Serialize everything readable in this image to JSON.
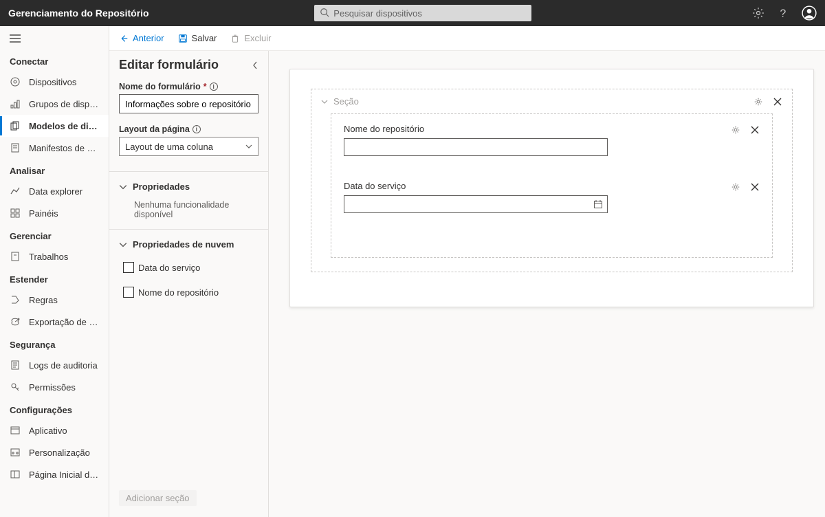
{
  "app": {
    "title": "Gerenciamento do Repositório"
  },
  "search": {
    "placeholder": "Pesquisar dispositivos"
  },
  "nav": {
    "groups": [
      {
        "title": "Conectar",
        "items": [
          {
            "icon": "device",
            "label": "Dispositivos"
          },
          {
            "icon": "group",
            "label": "Grupos de dispositivos"
          },
          {
            "icon": "template",
            "label": "Modelos de dispo...",
            "active": true
          },
          {
            "icon": "manifest",
            "label": "Manifestos de borda"
          }
        ]
      },
      {
        "title": "Analisar",
        "items": [
          {
            "icon": "chart",
            "label": "Data explorer"
          },
          {
            "icon": "dashboard",
            "label": "Painéis"
          }
        ]
      },
      {
        "title": "Gerenciar",
        "items": [
          {
            "icon": "jobs",
            "label": "Trabalhos"
          }
        ]
      },
      {
        "title": "Estender",
        "items": [
          {
            "icon": "rules",
            "label": "Regras"
          },
          {
            "icon": "export",
            "label": "Exportação de dados"
          }
        ]
      },
      {
        "title": "Segurança",
        "items": [
          {
            "icon": "audit",
            "label": "Logs de auditoria"
          },
          {
            "icon": "perm",
            "label": "Permissões"
          }
        ]
      },
      {
        "title": "Configurações",
        "items": [
          {
            "icon": "app",
            "label": "Aplicativo"
          },
          {
            "icon": "custom",
            "label": "Personalização"
          },
          {
            "icon": "home",
            "label": "Página Inicial do IoT C"
          }
        ]
      }
    ]
  },
  "cmdbar": {
    "back": "Anterior",
    "save": "Salvar",
    "delete": "Excluir"
  },
  "editor": {
    "title": "Editar formulário",
    "formNameLabel": "Nome do formulário",
    "formNameValue": "Informações sobre o repositório",
    "layoutLabel": "Layout da página",
    "layoutValue": "Layout de uma coluna",
    "propsHeader": "Propriedades",
    "propsEmpty": "Nenhuma funcionalidade disponível",
    "cloudPropsHeader": "Propriedades de nuvem",
    "cloudProps": [
      {
        "label": "Data do serviço"
      },
      {
        "label": "Nome do repositório"
      }
    ],
    "addSection": "Adicionar seção"
  },
  "canvas": {
    "sectionTitle": "Seção",
    "fields": [
      {
        "label": "Nome do repositório",
        "type": "text"
      },
      {
        "label": "Data do serviço",
        "type": "date"
      }
    ]
  }
}
